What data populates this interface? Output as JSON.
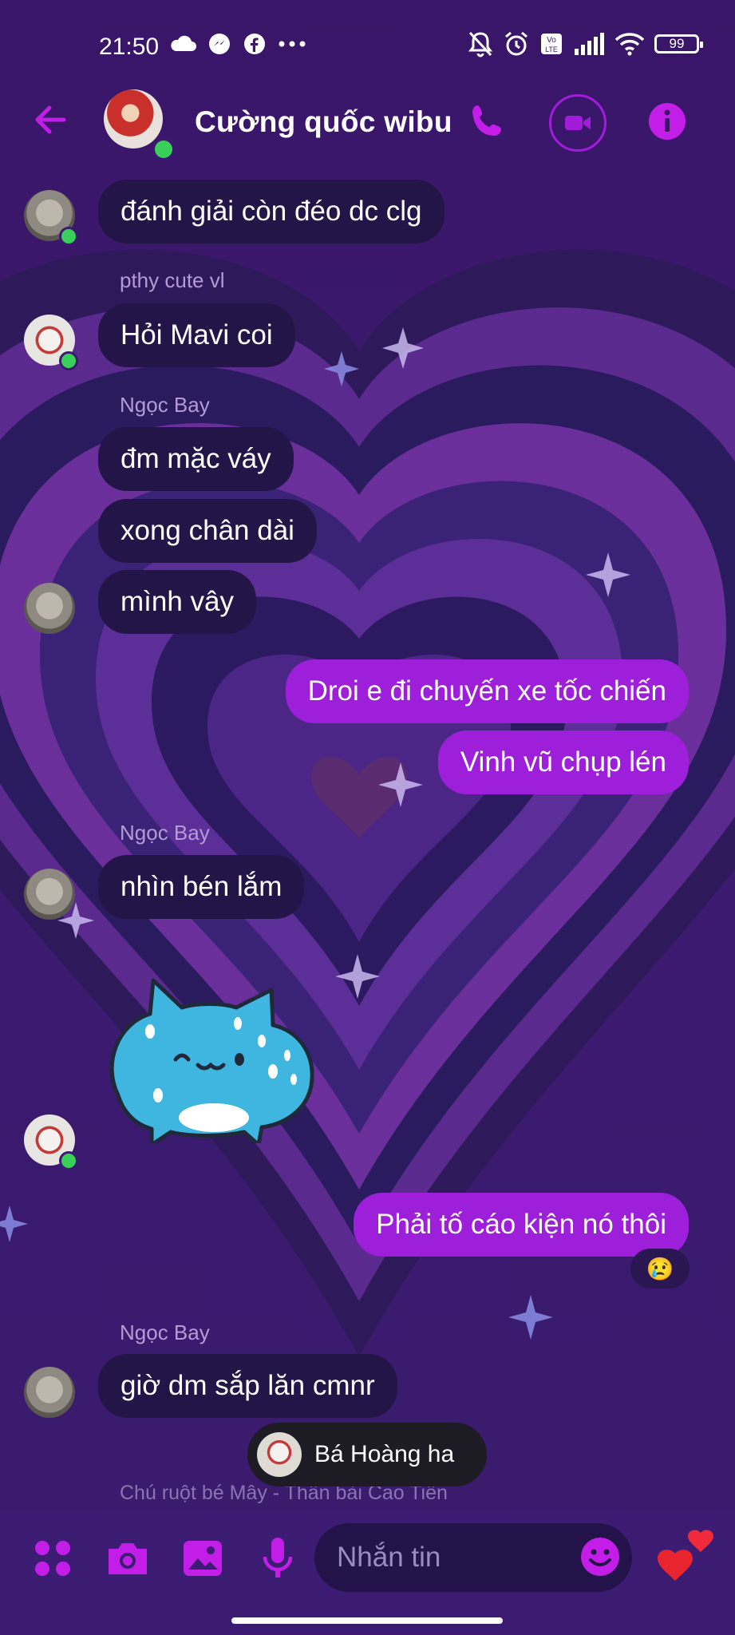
{
  "status_bar": {
    "time": "21:50",
    "battery": "99",
    "icons": [
      "cloud-icon",
      "messenger-icon",
      "facebook-icon",
      "more-dots-icon",
      "bell-off-icon",
      "alarm-icon",
      "volte-icon",
      "signal-icon",
      "wifi-icon",
      "battery-icon"
    ]
  },
  "header": {
    "title": "Cường quốc wibu",
    "icons": [
      "back-arrow-icon",
      "phone-icon",
      "video-icon",
      "info-icon"
    ]
  },
  "messages": [
    {
      "id": "m1",
      "sender": "",
      "text": "đánh giải còn đéo dc clg",
      "direction": "in"
    },
    {
      "id": "m2",
      "sender": "pthy cute vl",
      "text": "Hỏi Mavi coi",
      "direction": "in"
    },
    {
      "id": "m3",
      "sender": "Ngọc Bay",
      "text": "đm mặc váy",
      "direction": "in"
    },
    {
      "id": "m4",
      "sender": "",
      "text": "xong chân dài",
      "direction": "in"
    },
    {
      "id": "m5",
      "sender": "",
      "text": "mình vây",
      "direction": "in"
    },
    {
      "id": "m6",
      "sender": "",
      "text": "Droi e đi chuyến xe tốc chiến",
      "direction": "out"
    },
    {
      "id": "m7",
      "sender": "",
      "text": "Vinh vũ chụp lén",
      "direction": "out"
    },
    {
      "id": "m8",
      "sender": "Ngọc Bay",
      "text": "nhìn bén lắm",
      "direction": "in"
    },
    {
      "id": "m9",
      "sender": "",
      "text": "Phải tố cáo kiện nó thôi",
      "direction": "out",
      "reaction": "😢"
    },
    {
      "id": "m10",
      "sender": "Ngọc Bay",
      "text": "giờ dm sắp lăn cmnr",
      "direction": "in"
    }
  ],
  "typing": {
    "name": "Bá Hoàng ha"
  },
  "seen_line": "Chú ruột bé Mây - Thần bài Cao Tiến",
  "composer": {
    "placeholder": "Nhắn tin",
    "icons": [
      "apps-icon",
      "camera-icon",
      "gallery-icon",
      "microphone-icon",
      "emoji-icon",
      "hearts-icon"
    ]
  },
  "colors": {
    "accent": "#a01cd8",
    "outgoing_bubble": "#9d1fd9",
    "incoming_bubble": "#241548",
    "online": "#38d05a",
    "background": "#3a1a6e"
  }
}
